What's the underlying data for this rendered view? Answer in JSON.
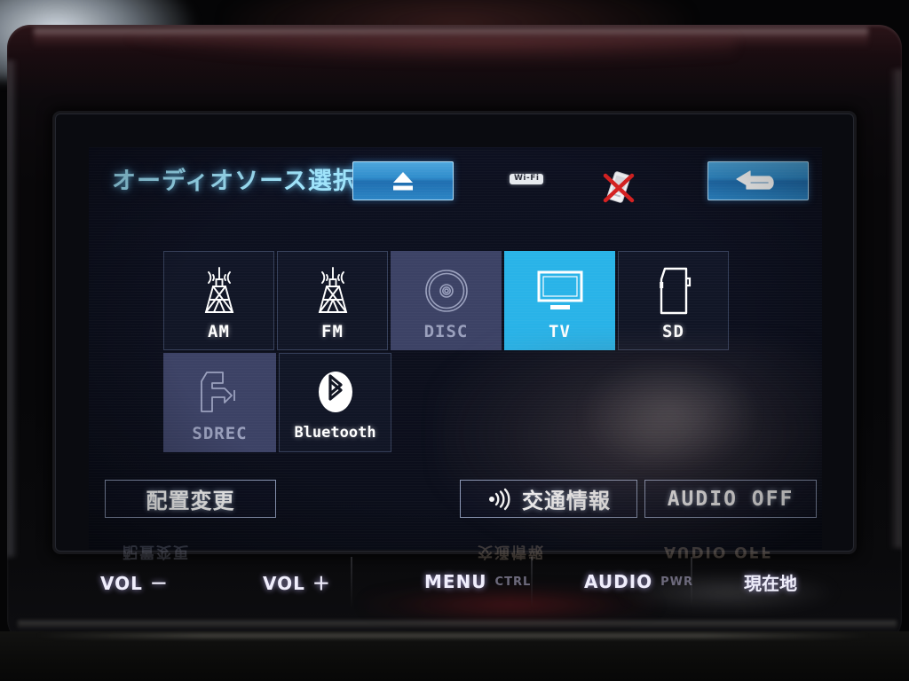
{
  "device": {
    "type": "car-navigation-head-unit",
    "accent_selected": "#29b3e8",
    "accent_title": "#9fe4fb",
    "disabled_tile": "#3c4265"
  },
  "screen": {
    "header": {
      "title": "オーディオソース選択",
      "eject_icon": "eject-icon",
      "wifi_badge": "Wi-Fi",
      "phone_status_icon": "phone-disconnected-icon",
      "back_icon": "return-arrow-icon"
    },
    "sources": [
      {
        "label": "AM",
        "icon": "radio-tower-icon",
        "state": "enabled"
      },
      {
        "label": "FM",
        "icon": "radio-tower-icon",
        "state": "enabled"
      },
      {
        "label": "DISC",
        "icon": "disc-icon",
        "state": "disabled"
      },
      {
        "label": "TV",
        "icon": "television-icon",
        "state": "selected"
      },
      {
        "label": "SD",
        "icon": "sd-card-icon",
        "state": "enabled"
      },
      {
        "label": "SDREC",
        "icon": "sd-record-icon",
        "state": "disabled"
      },
      {
        "label": "Bluetooth",
        "icon": "bluetooth-icon",
        "state": "enabled"
      }
    ],
    "actions": {
      "layout": "配置変更",
      "traffic": "交通情報",
      "traffic_icon": "broadcast-wave-icon",
      "audio_off": "AUDIO OFF"
    }
  },
  "hardkeys": [
    {
      "label": "VOL －",
      "sub": ""
    },
    {
      "label": "VOL ＋",
      "sub": ""
    },
    {
      "label": "MENU",
      "sub": "CTRL"
    },
    {
      "label": "AUDIO",
      "sub": "PWR"
    },
    {
      "label": "現在地",
      "sub": ""
    }
  ],
  "bezel_reflections": [
    "配置変更",
    "交通情報",
    "AUDIO OFF"
  ]
}
